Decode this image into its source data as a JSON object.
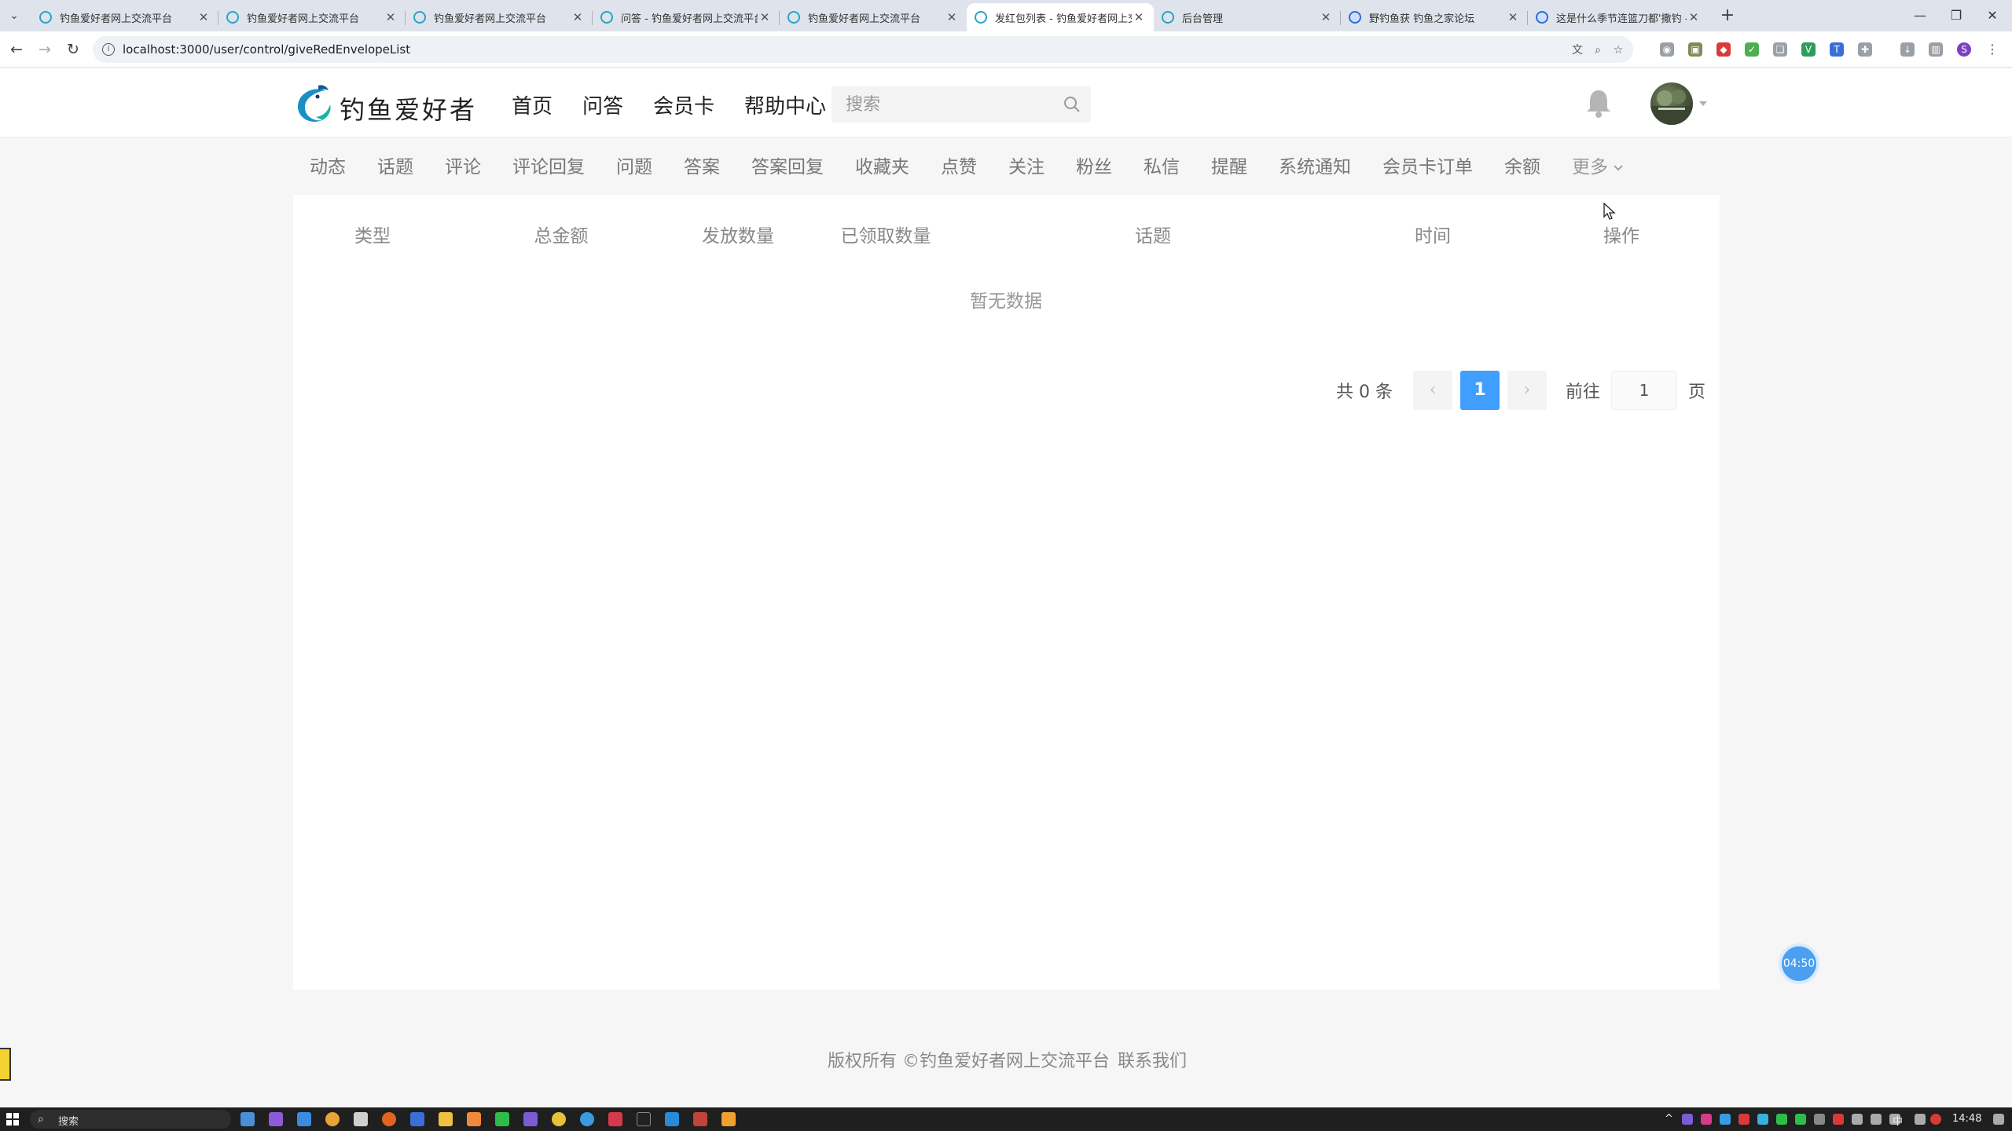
{
  "browser": {
    "tabs": [
      {
        "title": "钓鱼爱好者网上交流平台",
        "active": false
      },
      {
        "title": "钓鱼爱好者网上交流平台",
        "active": false
      },
      {
        "title": "钓鱼爱好者网上交流平台",
        "active": false
      },
      {
        "title": "问答 - 钓鱼爱好者网上交流平台",
        "active": false
      },
      {
        "title": "钓鱼爱好者网上交流平台",
        "active": false
      },
      {
        "title": "发红包列表 - 钓鱼爱好者网上交",
        "active": true
      },
      {
        "title": "后台管理",
        "active": false
      },
      {
        "title": "野钓鱼获 钓鱼之家论坛",
        "active": false
      },
      {
        "title": "这是什么季节连篮刀都'撒钓 - 钓",
        "active": false
      }
    ],
    "url": "localhost:3000/user/control/giveRedEnvelopeList"
  },
  "header": {
    "logo_text": "钓鱼爱好者",
    "nav": [
      "首页",
      "问答",
      "会员卡",
      "帮助中心"
    ],
    "search_placeholder": "搜索"
  },
  "subnav": {
    "items": [
      "动态",
      "话题",
      "评论",
      "评论回复",
      "问题",
      "答案",
      "答案回复",
      "收藏夹",
      "点赞",
      "关注",
      "粉丝",
      "私信",
      "提醒",
      "系统通知",
      "会员卡订单",
      "余额"
    ],
    "more_label": "更多"
  },
  "table": {
    "columns": [
      "类型",
      "总金额",
      "发放数量",
      "已领取数量",
      "话题",
      "时间",
      "操作"
    ],
    "empty_text": "暂无数据"
  },
  "pagination": {
    "total_text": "共 0 条",
    "current_page": "1",
    "goto_label": "前往",
    "goto_value": "1",
    "page_unit": "页"
  },
  "timer_badge": "04:50",
  "footer": {
    "copyright": "版权所有 ©钓鱼爱好者网上交流平台",
    "contact": "联系我们"
  },
  "taskbar": {
    "search_text": "搜索",
    "ime": "中",
    "clock": "14:48"
  },
  "colors": {
    "accent": "#409eff",
    "tab_favicon": "#29a3c9"
  }
}
